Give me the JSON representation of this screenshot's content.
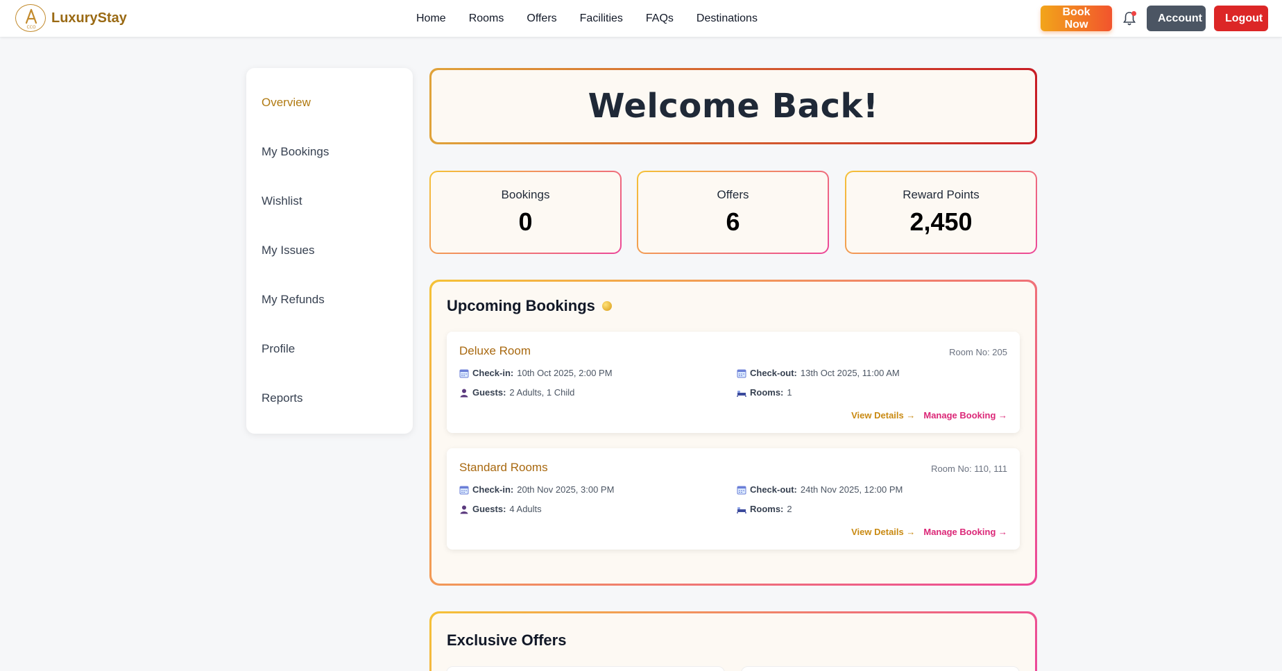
{
  "header": {
    "brand": "LuxuryStay",
    "nav": [
      "Home",
      "Rooms",
      "Offers",
      "Facilities",
      "FAQs",
      "Destinations"
    ],
    "book_now": "Book Now",
    "account": "Account",
    "logout": "Logout"
  },
  "sidebar": {
    "items": [
      {
        "label": "Overview",
        "active": true
      },
      {
        "label": "My Bookings",
        "active": false
      },
      {
        "label": "Wishlist",
        "active": false
      },
      {
        "label": "My Issues",
        "active": false
      },
      {
        "label": "My Refunds",
        "active": false
      },
      {
        "label": "Profile",
        "active": false
      },
      {
        "label": "Reports",
        "active": false
      }
    ]
  },
  "welcome": {
    "title": "Welcome Back!"
  },
  "stats": [
    {
      "label": "Bookings",
      "value": "0"
    },
    {
      "label": "Offers",
      "value": "6"
    },
    {
      "label": "Reward Points",
      "value": "2,450"
    }
  ],
  "upcoming": {
    "title": "Upcoming Bookings",
    "bookings": [
      {
        "room": "Deluxe Room",
        "room_no": "Room No: 205",
        "checkin_label": "Check-in:",
        "checkin": "10th Oct 2025, 2:00 PM",
        "checkout_label": "Check-out:",
        "checkout": "13th Oct 2025, 11:00 AM",
        "guests_label": "Guests:",
        "guests": "2 Adults, 1 Child",
        "rooms_label": "Rooms:",
        "rooms": "1",
        "view": "View Details →",
        "manage": "Manage Booking →"
      },
      {
        "room": "Standard Rooms",
        "room_no": "Room No: 110, 111",
        "checkin_label": "Check-in:",
        "checkin": "20th Nov 2025, 3:00 PM",
        "checkout_label": "Check-out:",
        "checkout": "24th Nov 2025, 12:00 PM",
        "guests_label": "Guests:",
        "guests": "4 Adults",
        "rooms_label": "Rooms:",
        "rooms": "2",
        "view": "View Details →",
        "manage": "Manage Booking →"
      }
    ]
  },
  "offers": {
    "title": "Exclusive Offers"
  },
  "colors": {
    "brand": "#9a6a14",
    "accent_gold": "#f5c236",
    "accent_pink": "#ec4899",
    "logout": "#dc2626",
    "account": "#4b5563"
  }
}
